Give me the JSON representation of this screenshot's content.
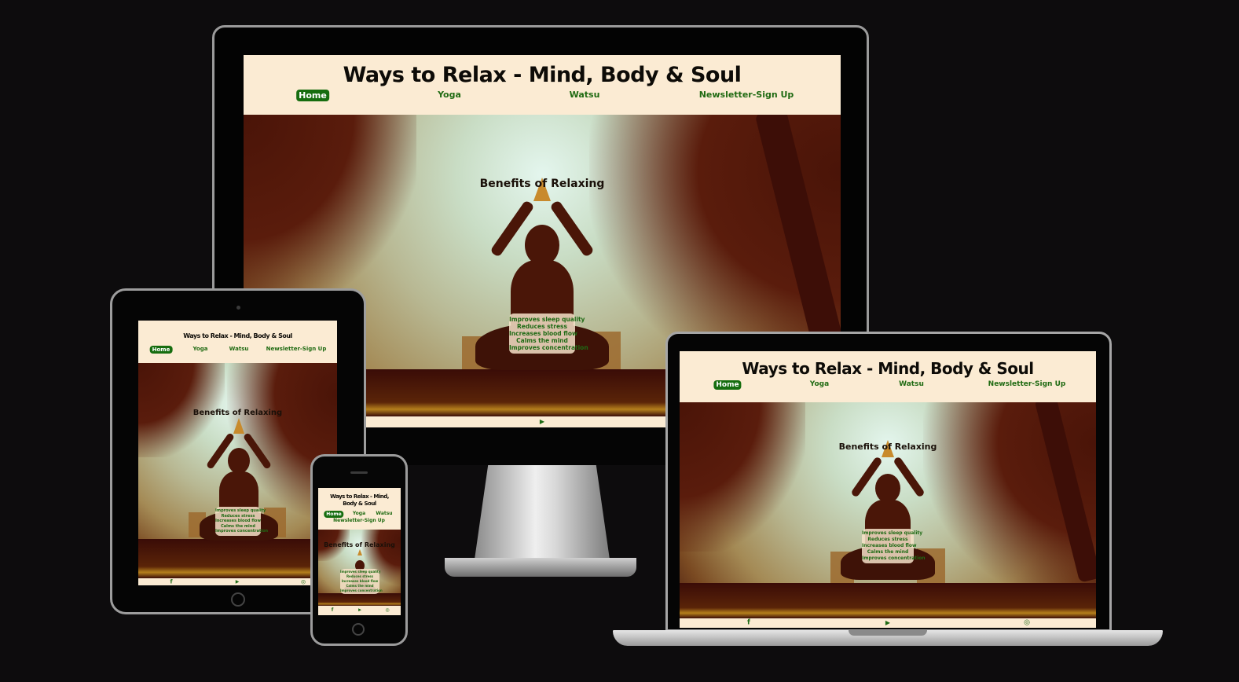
{
  "site": {
    "title": "Ways to Relax - Mind, Body & Soul",
    "title_wrapped_line1": "Ways to Relax - Mind,",
    "title_wrapped_line2": "Body & Soul",
    "nav": [
      "Home",
      "Yoga",
      "Watsu",
      "Newsletter-Sign Up"
    ],
    "active_nav": "Home",
    "hero_heading": "Benefits of Relaxing",
    "benefits": [
      "Improves sleep quality",
      "Reduces stress",
      "Increases blood flow",
      "Calms the mind",
      "Improves concentration"
    ],
    "footer_icons": [
      "facebook-icon",
      "youtube-icon",
      "instagram-icon"
    ],
    "footer_glyphs": {
      "facebook": "f",
      "youtube": "▶",
      "instagram": "◎"
    }
  },
  "colors": {
    "background": "#0d0c0d",
    "header_bg": "#fbebd3",
    "nav_green": "#1f6a12",
    "active_nav_bg": "#166d0f"
  },
  "devices": [
    "desktop-monitor",
    "tablet",
    "laptop",
    "phone"
  ]
}
